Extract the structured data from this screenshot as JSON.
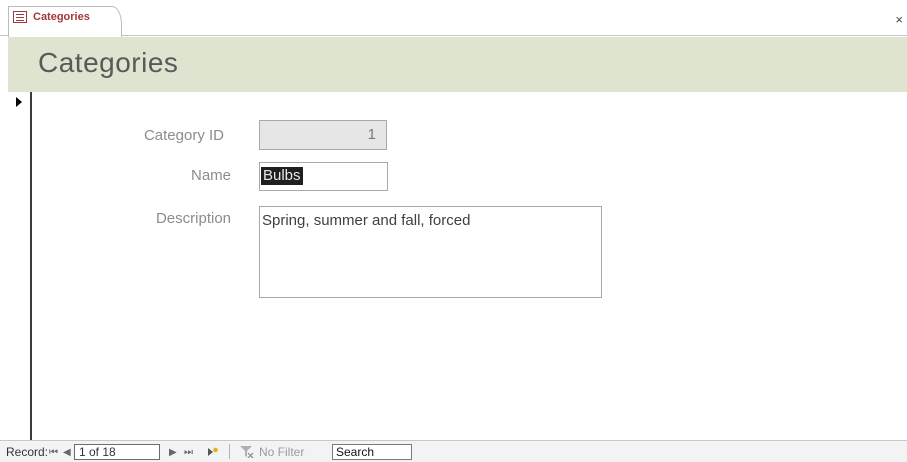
{
  "tab": {
    "label": "Categories",
    "close": "×"
  },
  "form": {
    "title": "Categories",
    "fields": {
      "category_id": {
        "label": "Category ID",
        "value": "1"
      },
      "name": {
        "label": "Name",
        "value": "Bulbs"
      },
      "description": {
        "label": "Description",
        "value": "Spring, summer and fall, forced"
      }
    }
  },
  "navigation": {
    "label": "Record:",
    "first": "⏮",
    "prev": "◀",
    "current": "1 of 18",
    "next": "▶",
    "last": "⏭",
    "filter_status": "No Filter",
    "search": "Search"
  },
  "colors": {
    "header_band": "#dfe4d0",
    "tab_text": "#a4373a",
    "label_text": "#8c8c8c"
  },
  "icons": {
    "tab": "form-icon",
    "new_record": "new-record-icon",
    "filter": "filter-icon",
    "record_selector": "current-record-arrow-icon"
  }
}
